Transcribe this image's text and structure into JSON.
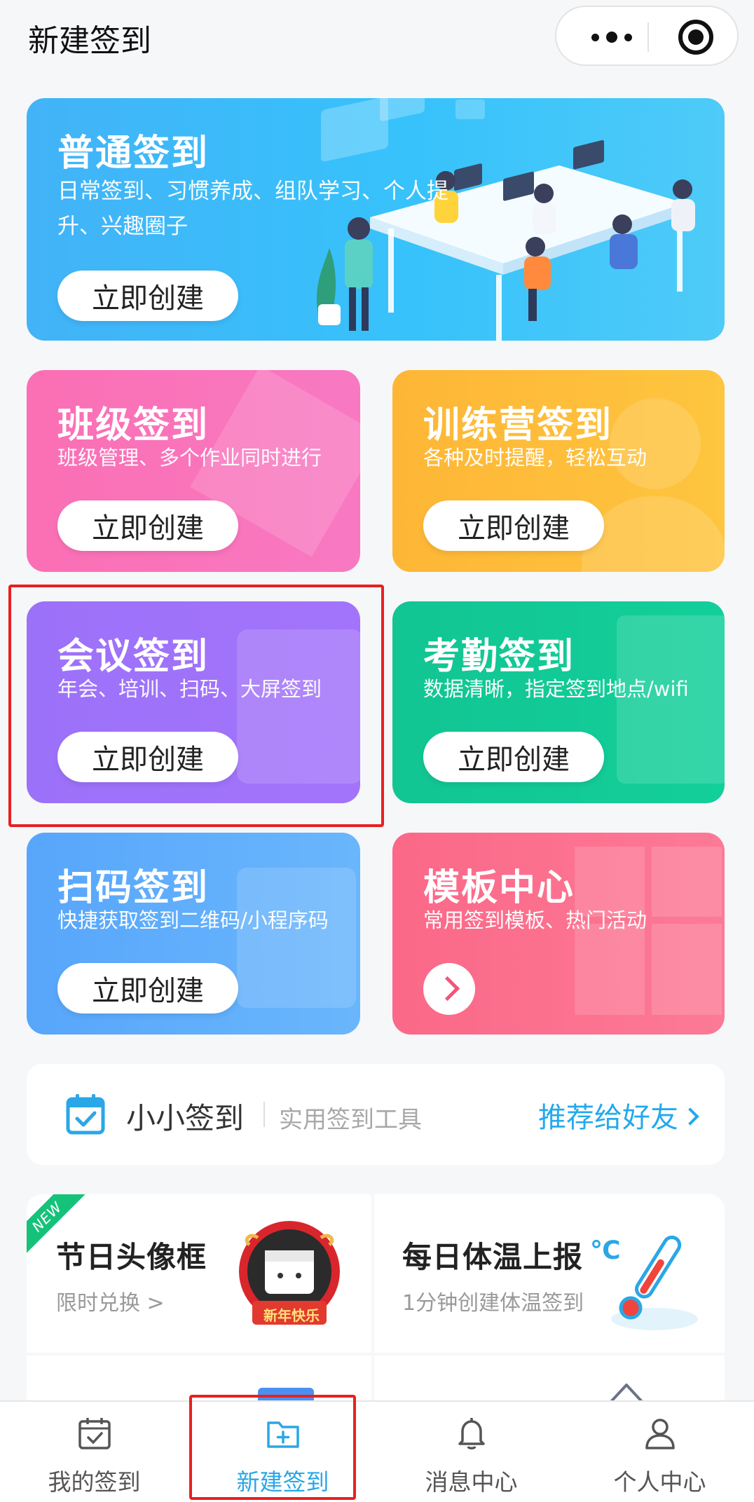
{
  "header": {
    "title": "新建签到"
  },
  "cards": {
    "normal": {
      "title": "普通签到",
      "desc": "日常签到、习惯养成、组队学习、个人提升、兴趣圈子",
      "button": "立即创建"
    },
    "class": {
      "title": "班级签到",
      "desc": "班级管理、多个作业同时进行",
      "button": "立即创建"
    },
    "camp": {
      "title": "训练营签到",
      "desc": "各种及时提醒，轻松互动",
      "button": "立即创建"
    },
    "meeting": {
      "title": "会议签到",
      "desc": "年会、培训、扫码、大屏签到",
      "button": "立即创建"
    },
    "attendance": {
      "title": "考勤签到",
      "desc": "数据清晰，指定签到地点/wifi",
      "button": "立即创建"
    },
    "scan": {
      "title": "扫码签到",
      "desc": "快捷获取签到二维码/小程序码",
      "button": "立即创建"
    },
    "template": {
      "title": "模板中心",
      "desc": "常用签到模板、热门活动"
    }
  },
  "brand": {
    "name": "小小签到",
    "subtitle": "实用签到工具",
    "recommend": "推荐给好友"
  },
  "promos": {
    "avatar_frame": {
      "badge": "NEW",
      "title": "节日头像框",
      "subtitle": "限时兑换 >",
      "art_text": "新年快乐"
    },
    "temperature": {
      "title": "每日体温上报",
      "subtitle": "1分钟创建体温签到"
    }
  },
  "tabbar": {
    "items": [
      {
        "label": "我的签到",
        "icon": "calendar-check-icon"
      },
      {
        "label": "新建签到",
        "icon": "folder-plus-icon"
      },
      {
        "label": "消息中心",
        "icon": "bell-icon"
      },
      {
        "label": "个人中心",
        "icon": "user-icon"
      }
    ],
    "active_index": 1
  },
  "colors": {
    "accent": "#2aa7e6",
    "highlight": "#e82020",
    "card_normal": "#3bb9f9",
    "card_class": "#fa73bb",
    "card_camp": "#febd3a",
    "card_meeting": "#9f72fa",
    "card_attendance": "#12ca96",
    "card_scan": "#61affb",
    "card_template": "#fb708f"
  }
}
